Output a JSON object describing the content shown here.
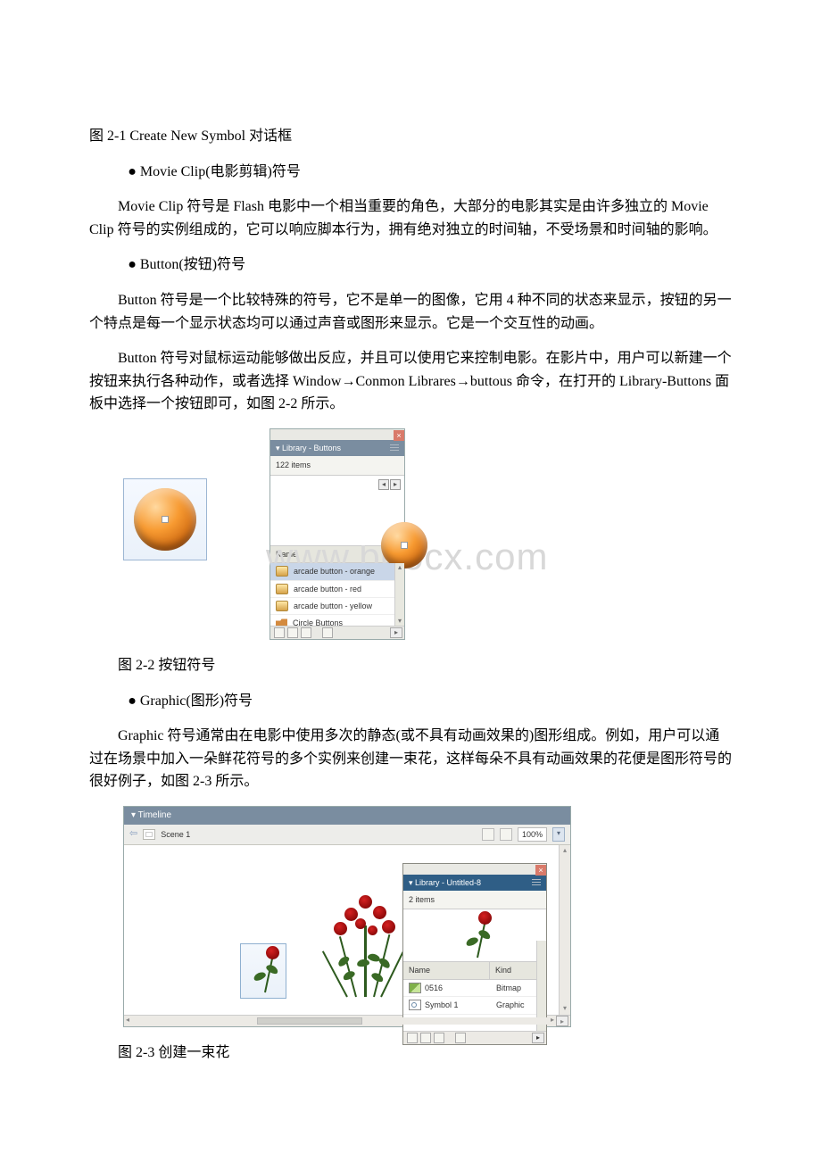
{
  "captions": {
    "fig21": "图 2-1  Create New Symbol 对话框",
    "fig22": "图 2-2  按钮符号",
    "fig23": "图 2-3  创建一束花"
  },
  "bullets": {
    "movieclip": "● Movie Clip(电影剪辑)符号",
    "button": "● Button(按钮)符号",
    "graphic": "● Graphic(图形)符号"
  },
  "paras": {
    "p1": "Movie Clip 符号是 Flash 电影中一个相当重要的角色，大部分的电影其实是由许多独立的 Movie Clip 符号的实例组成的，它可以响应脚本行为，拥有绝对独立的时间轴，不受场景和时间轴的影响。",
    "p2": "Button 符号是一个比较特殊的符号，它不是单一的图像，它用 4 种不同的状态来显示，按钮的另一个特点是每一个显示状态均可以通过声音或图形来显示。它是一个交互性的动画。",
    "p3": "Button 符号对鼠标运动能够做出反应，并且可以使用它来控制电影。在影片中，用户可以新建一个按钮来执行各种动作，或者选择 Window→Conmon Librares→buttous 命令，在打开的 Library-Buttons 面板中选择一个按钮即可，如图 2-2 所示。",
    "p4": "Graphic 符号通常由在电影中使用多次的静态(或不具有动画效果的)图形组成。例如，用户可以通过在场景中加入一朵鲜花符号的多个实例来创建一束花，这样每朵不具有动画效果的花便是图形符号的很好例子，如图 2-3 所示。"
  },
  "watermark": "www.bdocx.com",
  "fig22": {
    "panel_title": "▾ Library - Buttons",
    "item_count": "122 items",
    "col_name": "Name",
    "rows": [
      "arcade button - orange",
      "arcade button - red",
      "arcade button - yellow",
      "Circle Buttons"
    ]
  },
  "fig23": {
    "timeline": "▾ Timeline",
    "scene": "Scene 1",
    "zoom": "100%",
    "lib_title": "▾ Library - Untitled-8",
    "lib_count": "2 items",
    "col_name": "Name",
    "col_kind": "Kind",
    "rows": [
      {
        "name": "0516",
        "kind": "Bitmap"
      },
      {
        "name": "Symbol 1",
        "kind": "Graphic"
      }
    ]
  }
}
